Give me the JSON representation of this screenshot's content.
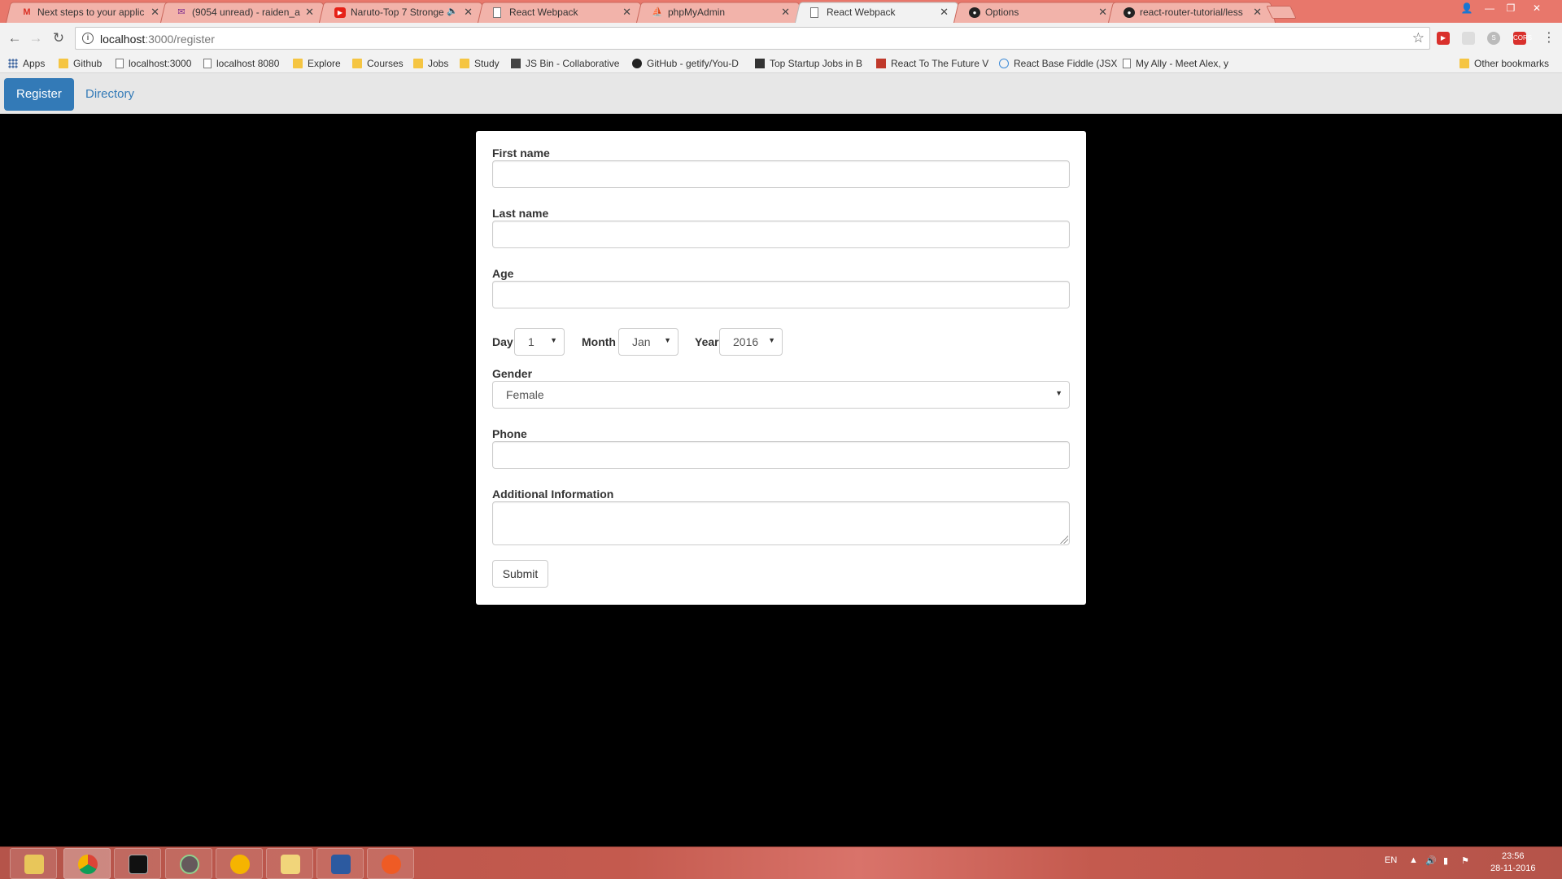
{
  "browser": {
    "tabs": [
      {
        "title": "Next steps to your applic",
        "icon": "gmail-icon",
        "color": "#d93025"
      },
      {
        "title": "(9054 unread) - raiden_a",
        "icon": "mail-icon",
        "color": "#7b2a8d"
      },
      {
        "title": "Naruto-Top 7 Stronge",
        "icon": "youtube-icon",
        "color": "#e62117"
      },
      {
        "title": "React Webpack",
        "icon": "page-icon",
        "color": "#777777"
      },
      {
        "title": "phpMyAdmin",
        "icon": "phpmyadmin-icon",
        "color": "#f29111"
      },
      {
        "title": "React Webpack",
        "icon": "page-icon",
        "color": "#777777"
      },
      {
        "title": "Options",
        "icon": "github-icon",
        "color": "#222222"
      },
      {
        "title": "react-router-tutorial/less",
        "icon": "github-icon",
        "color": "#222222"
      }
    ],
    "address": {
      "host": "localhost",
      "path": ":3000/register"
    },
    "bookmarks": [
      {
        "label": "Apps",
        "type": "apps"
      },
      {
        "label": "Github",
        "type": "folder"
      },
      {
        "label": "localhost:3000",
        "type": "page"
      },
      {
        "label": "localhost 8080",
        "type": "page"
      },
      {
        "label": "Explore",
        "type": "folder"
      },
      {
        "label": "Courses",
        "type": "folder"
      },
      {
        "label": "Jobs",
        "type": "folder"
      },
      {
        "label": "Study",
        "type": "folder"
      },
      {
        "label": "JS Bin - Collaborative",
        "type": "jsbin"
      },
      {
        "label": "GitHub - getify/You-D",
        "type": "github"
      },
      {
        "label": "Top Startup Jobs in B",
        "type": "angellist"
      },
      {
        "label": "React To The Future V",
        "type": "speakerdeck"
      },
      {
        "label": "React Base Fiddle (JSX",
        "type": "jsfiddle"
      },
      {
        "label": "My Ally - Meet Alex, y",
        "type": "page"
      }
    ],
    "other_bookmarks": "Other bookmarks"
  },
  "app": {
    "nav": [
      {
        "label": "Register",
        "active": true
      },
      {
        "label": "Directory",
        "active": false
      }
    ],
    "form": {
      "first_name_label": "First name",
      "last_name_label": "Last name",
      "age_label": "Age",
      "day_label": "Day",
      "day_value": "1",
      "month_label": "Month",
      "month_value": "Jan",
      "year_label": "Year",
      "year_value": "2016",
      "gender_label": "Gender",
      "gender_value": "Female",
      "phone_label": "Phone",
      "additional_label": "Additional Information",
      "submit_label": "Submit"
    }
  },
  "taskbar": {
    "apps": [
      "file-explorer",
      "chrome",
      "command-prompt",
      "atom",
      "chrome-canary",
      "folder",
      "powershell",
      "postman"
    ],
    "language": "EN",
    "time": "23:56",
    "date": "28-11-2016"
  },
  "colors": {
    "primary": "#337ab7",
    "tabstrip": "#e8776b",
    "taskbar": "#c45a4e"
  }
}
